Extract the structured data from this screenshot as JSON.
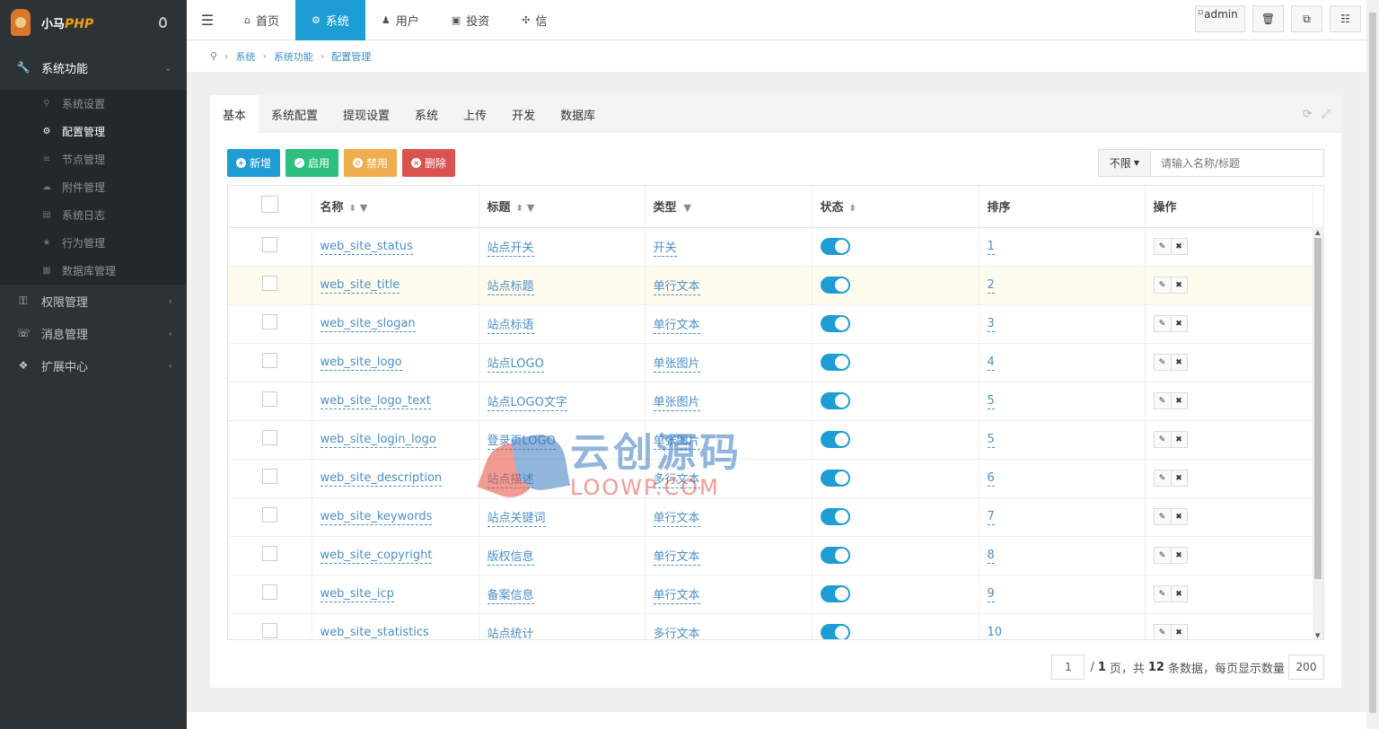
{
  "sidebar": {
    "brand_prefix": "小马",
    "brand_suffix": "PHP",
    "groups": [
      {
        "label": "系统功能",
        "icon": "wrench-icon"
      },
      {
        "label": "权限管理",
        "icon": "key-icon"
      },
      {
        "label": "消息管理",
        "icon": "comments-icon"
      },
      {
        "label": "扩展中心",
        "icon": "cubes-icon"
      }
    ],
    "sub_items": [
      {
        "label": "系统设置",
        "icon": "wrench-icon"
      },
      {
        "label": "配置管理",
        "icon": "cogs-icon"
      },
      {
        "label": "节点管理",
        "icon": "list-icon"
      },
      {
        "label": "附件管理",
        "icon": "cloud-icon"
      },
      {
        "label": "系统日志",
        "icon": "book-icon"
      },
      {
        "label": "行为管理",
        "icon": "star-icon"
      },
      {
        "label": "数据库管理",
        "icon": "database-icon"
      }
    ]
  },
  "topnav": {
    "tabs": [
      {
        "label": "首页",
        "icon": "home-icon"
      },
      {
        "label": "系统",
        "icon": "gear-icon"
      },
      {
        "label": "用户",
        "icon": "user-icon"
      },
      {
        "label": "投资",
        "icon": "briefcase-icon"
      },
      {
        "label": "信",
        "icon": "fan-icon"
      }
    ],
    "admin_alt": "admin"
  },
  "breadcrumb": {
    "items": [
      "系统",
      "系统功能",
      "配置管理"
    ]
  },
  "panel": {
    "tabs": [
      "基本",
      "系统配置",
      "提现设置",
      "系统",
      "上传",
      "开发",
      "数据库"
    ],
    "buttons": {
      "add": "新增",
      "enable": "启用",
      "disable": "禁用",
      "delete": "删除"
    },
    "search": {
      "select": "不限",
      "placeholder": "请输入名称/标题"
    }
  },
  "table": {
    "headers": {
      "name": "名称",
      "title": "标题",
      "type": "类型",
      "status": "状态",
      "sort": "排序",
      "ops": "操作"
    },
    "rows": [
      {
        "name": "web_site_status",
        "title": "站点开关",
        "type": "开关",
        "sort": "1",
        "status": true
      },
      {
        "name": "web_site_title",
        "title": "站点标题",
        "type": "单行文本",
        "sort": "2",
        "status": true
      },
      {
        "name": "web_site_slogan",
        "title": "站点标语",
        "type": "单行文本",
        "sort": "3",
        "status": true
      },
      {
        "name": "web_site_logo",
        "title": "站点LOGO",
        "type": "单张图片",
        "sort": "4",
        "status": true
      },
      {
        "name": "web_site_logo_text",
        "title": "站点LOGO文字",
        "type": "单张图片",
        "sort": "5",
        "status": true
      },
      {
        "name": "web_site_login_logo",
        "title": "登录页LOGO",
        "type": "单张图片",
        "sort": "5",
        "status": true
      },
      {
        "name": "web_site_description",
        "title": "站点描述",
        "type": "多行文本",
        "sort": "6",
        "status": true
      },
      {
        "name": "web_site_keywords",
        "title": "站点关键词",
        "type": "单行文本",
        "sort": "7",
        "status": true
      },
      {
        "name": "web_site_copyright",
        "title": "版权信息",
        "type": "单行文本",
        "sort": "8",
        "status": true
      },
      {
        "name": "web_site_icp",
        "title": "备案信息",
        "type": "单行文本",
        "sort": "9",
        "status": true
      },
      {
        "name": "web_site_statistics",
        "title": "站点统计",
        "type": "多行文本",
        "sort": "10",
        "status": true
      }
    ]
  },
  "pager": {
    "current": "1",
    "sep": "/",
    "total_pages": "1",
    "page_word": "页，共",
    "total_count": "12",
    "count_word": "条数据，每页显示数量",
    "page_size": "200"
  },
  "watermark": {
    "line1": "云创源码",
    "line2": "LOOWP.COM"
  },
  "colors": {
    "accent": "#1e9dd4",
    "sidebar": "#2c3236",
    "success": "#2dbf7d",
    "warning": "#f0ad4e",
    "danger": "#d9534f"
  }
}
